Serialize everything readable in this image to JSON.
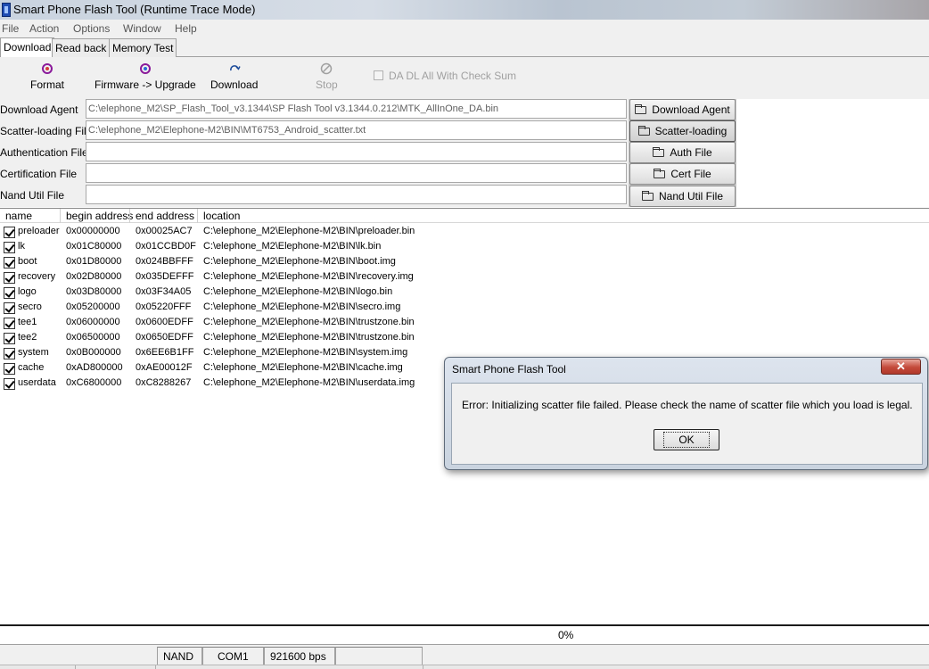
{
  "window": {
    "title": "Smart Phone Flash Tool (Runtime Trace Mode)"
  },
  "menu": [
    "File",
    "Action",
    "Options",
    "Window",
    "Help"
  ],
  "tabs": [
    "Download",
    "Read back",
    "Memory Test"
  ],
  "toolbar": {
    "format": "Format",
    "firmware_upgrade": "Firmware -> Upgrade",
    "download": "Download",
    "stop": "Stop",
    "da_checksum": "DA DL All With Check Sum"
  },
  "files": {
    "download_agent": {
      "label": "Download Agent",
      "value": "C:\\elephone_M2\\SP_Flash_Tool_v3.1344\\SP Flash Tool v3.1344.0.212\\MTK_AllInOne_DA.bin",
      "button": "Download Agent"
    },
    "scatter": {
      "label": "Scatter-loading File",
      "value": "C:\\elephone_M2\\Elephone-M2\\BIN\\MT6753_Android_scatter.txt",
      "button": "Scatter-loading"
    },
    "auth": {
      "label": "Authentication File",
      "value": "",
      "button": "Auth File"
    },
    "cert": {
      "label": "Certification File",
      "value": "",
      "button": "Cert File"
    },
    "nand": {
      "label": "Nand Util File",
      "value": "",
      "button": "Nand Util File"
    }
  },
  "table": {
    "headers": [
      "name",
      "begin address",
      "end address",
      "location"
    ],
    "rows": [
      {
        "name": "preloader",
        "begin": "0x00000000",
        "end": "0x00025AC7",
        "location": "C:\\elephone_M2\\Elephone-M2\\BIN\\preloader.bin"
      },
      {
        "name": "lk",
        "begin": "0x01C80000",
        "end": "0x01CCBD0F",
        "location": "C:\\elephone_M2\\Elephone-M2\\BIN\\lk.bin"
      },
      {
        "name": "boot",
        "begin": "0x01D80000",
        "end": "0x024BBFFF",
        "location": "C:\\elephone_M2\\Elephone-M2\\BIN\\boot.img"
      },
      {
        "name": "recovery",
        "begin": "0x02D80000",
        "end": "0x035DEFFF",
        "location": "C:\\elephone_M2\\Elephone-M2\\BIN\\recovery.img"
      },
      {
        "name": "logo",
        "begin": "0x03D80000",
        "end": "0x03F34A05",
        "location": "C:\\elephone_M2\\Elephone-M2\\BIN\\logo.bin"
      },
      {
        "name": "secro",
        "begin": "0x05200000",
        "end": "0x05220FFF",
        "location": "C:\\elephone_M2\\Elephone-M2\\BIN\\secro.img"
      },
      {
        "name": "tee1",
        "begin": "0x06000000",
        "end": "0x0600EDFF",
        "location": "C:\\elephone_M2\\Elephone-M2\\BIN\\trustzone.bin"
      },
      {
        "name": "tee2",
        "begin": "0x06500000",
        "end": "0x0650EDFF",
        "location": "C:\\elephone_M2\\Elephone-M2\\BIN\\trustzone.bin"
      },
      {
        "name": "system",
        "begin": "0x0B000000",
        "end": "0x6EE6B1FF",
        "location": "C:\\elephone_M2\\Elephone-M2\\BIN\\system.img"
      },
      {
        "name": "cache",
        "begin": "0xAD800000",
        "end": "0xAE00012F",
        "location": "C:\\elephone_M2\\Elephone-M2\\BIN\\cache.img"
      },
      {
        "name": "userdata",
        "begin": "0xC6800000",
        "end": "0xC8288267",
        "location": "C:\\elephone_M2\\Elephone-M2\\BIN\\userdata.img"
      }
    ]
  },
  "progress": {
    "text": "0%",
    "value": 0
  },
  "status": {
    "storage": "NAND",
    "port": "COM1",
    "baud": "921600 bps"
  },
  "dialog": {
    "title": "Smart Phone Flash Tool",
    "close": "✕",
    "message": "Error: Initializing scatter file failed. Please check the name of scatter file which you load is legal.",
    "ok": "OK"
  },
  "icons": {
    "format": "format-icon",
    "firmware": "firmware-upgrade-icon",
    "download": "download-icon",
    "stop": "stop-icon",
    "folder": "folder-icon"
  },
  "colors": {
    "titlebar": "#c9d3df",
    "close_button": "#c4493a",
    "panel_gray": "#c8c8c8"
  }
}
